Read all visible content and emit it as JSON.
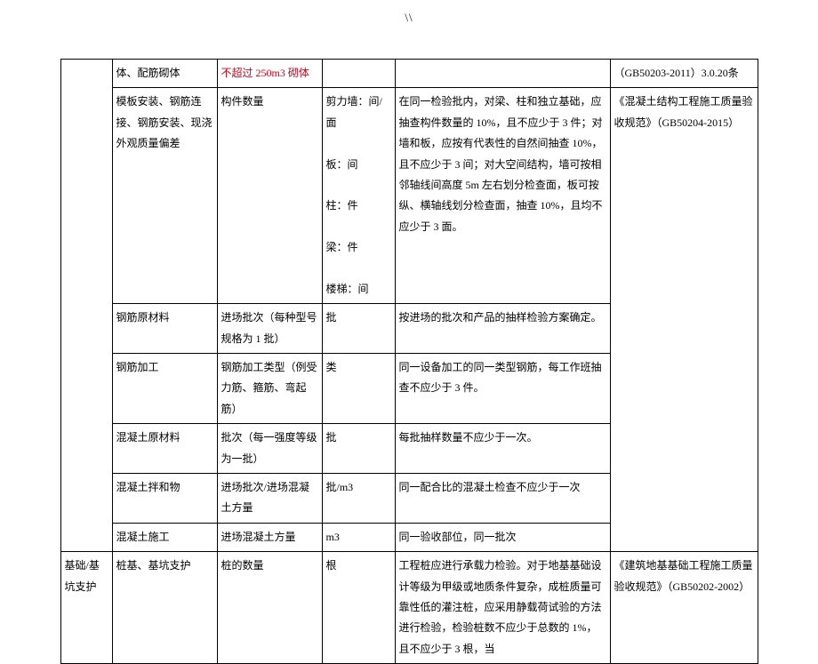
{
  "page_marker": "\\\\",
  "rows": [
    {
      "c1": "",
      "c2": "体、配筋砌体",
      "c3": "不超过 250m3 砌体",
      "c4": "",
      "c5": "",
      "c6": "（GB50203-2011）3.0.20条"
    },
    {
      "c1": "",
      "c2": "模板安装、钢筋连接、钢筋安装、现浇外观质量偏差",
      "c3": "构件数量",
      "c4": "剪力墙：间/面\n\n板：间\n\n柱：件\n\n梁：件\n\n楼梯：间",
      "c5": "在同一检验批内，对梁、柱和独立基础，应抽查构件数量的 10%，且不应少于 3 件；对墙和板，应按有代表性的自然间抽查 10%，且不应少于 3 间；对大空间结构，墙可按相邻轴线间高度 5m 左右划分检查面，板可按纵、横轴线划分检查面，抽查 10%，且均不应少于 3 面。",
      "c6": "《混凝土结构工程施工质量验收规范》（GB50204-2015）"
    },
    {
      "c1": "",
      "c2": "钢筋原材料",
      "c3": "进场批次（每种型号规格为 1 批）",
      "c4": "批",
      "c5": "按进场的批次和产品的抽样检验方案确定。",
      "c6_merge": true
    },
    {
      "c1": "",
      "c2": "钢筋加工",
      "c3": "钢筋加工类型（例受力筋、箍筋、弯起筋）",
      "c4": "类",
      "c5": "同一设备加工的同一类型钢筋，每工作班抽查不应少于 3 件。",
      "c6_merge": true
    },
    {
      "c1": "",
      "c2": "混凝土原材料",
      "c3": "批次（每一强度等级为一批）",
      "c4": "批",
      "c5": "每批抽样数量不应少于一次。",
      "c6_merge": true
    },
    {
      "c1": "",
      "c2": "混凝土拌和物",
      "c3": "进场批次/进场混凝土方量",
      "c4": "批/m3",
      "c5": "同一配合比的混凝土检查不应少于一次",
      "c6_merge": true
    },
    {
      "c1": "",
      "c2": "混凝土施工",
      "c3": "进场混凝土方量",
      "c4": "m3",
      "c5": "同一验收部位，同一批次",
      "c6_merge": true
    },
    {
      "c1": "基础/基坑支护",
      "c2": "桩基、基坑支护",
      "c3": "桩的数量",
      "c4": "根",
      "c5": "工程桩应进行承载力检验。对于地基基础设计等级为甲级或地质条件复杂，成桩质量可靠性低的灌注桩，应采用静载荷试验的方法进行检验，检验桩数不应少于总数的 1%，且不应少于 3 根，当",
      "c6": "《建筑地基基础工程施工质量验收规范》（GB50202-2002）"
    }
  ]
}
